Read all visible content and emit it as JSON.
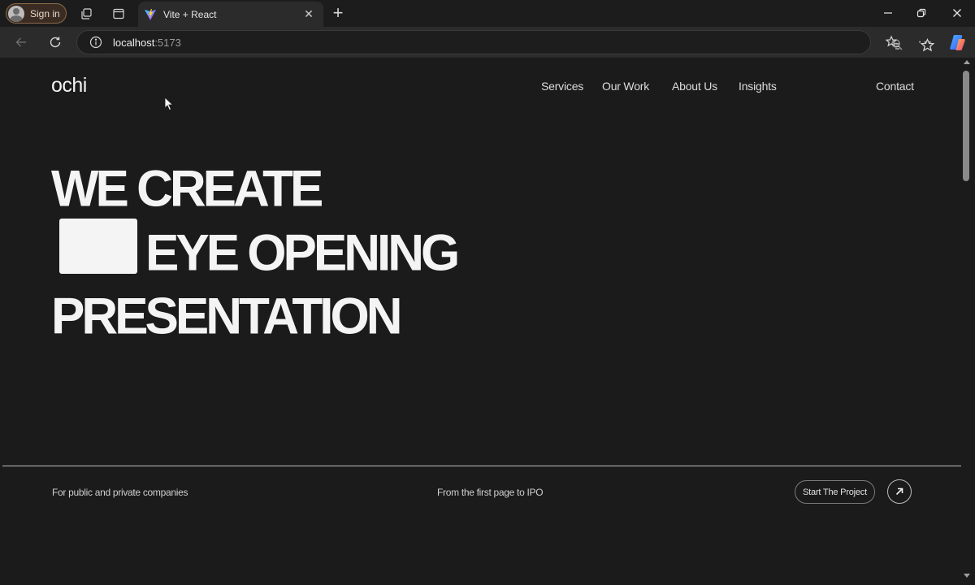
{
  "browser": {
    "profile_label": "Sign in",
    "tab_title": "Vite + React",
    "url_host": "localhost",
    "url_port": ":5173",
    "icons": {
      "tab_actions": "tab-actions-icon",
      "vertical_tabs": "vertical-tabs-icon",
      "favicon": "vite-logo-icon",
      "back": "back-arrow-icon",
      "refresh": "refresh-icon",
      "info": "info-icon",
      "zoom": "zoom-icon",
      "favorite": "star-icon",
      "favorites": "favorites-icon",
      "more": "more-icon",
      "copilot": "copilot-icon"
    }
  },
  "site": {
    "logo": "ochi",
    "nav": {
      "services": "Services",
      "work": "Our Work",
      "about": "About Us",
      "insights": "Insights",
      "contact": "Contact"
    },
    "hero": {
      "line1": "WE CREATE",
      "line2": "EYE OPENING",
      "line3": "PRESENTATION"
    },
    "footer": {
      "left": "For public and private companies",
      "middle": "From the first page to IPO",
      "cta": "Start The Project"
    }
  },
  "colors": {
    "page_bg": "#1b1b1b",
    "text": "#f4f4f4",
    "chrome_bg": "#2b2b2b"
  }
}
